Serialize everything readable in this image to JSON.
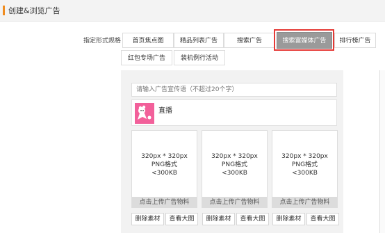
{
  "header": {
    "title": "创建&浏览广告",
    "accent_color": "#f08c1f"
  },
  "format": {
    "label": "指定形式规格",
    "options": [
      "首页焦点图",
      "精品列表广告",
      "搜索广告",
      "搜索富媒体广告",
      "排行榜广告",
      "红包专场广告",
      "装机例行活动"
    ],
    "selected": "搜索富媒体广告"
  },
  "editor": {
    "text_input_placeholder": "请输入广告宣传语（不超过20个字）",
    "live_label": "直播",
    "live_thumb_color": "#f2609a",
    "cards": [
      {
        "size": "320px * 320px",
        "format": "PNG格式",
        "limit": "<300KB",
        "upload_label": "点击上传广告物料",
        "delete_label": "删除素材",
        "view_label": "查看大图"
      },
      {
        "size": "320px * 320px",
        "format": "PNG格式",
        "limit": "<300KB",
        "upload_label": "点击上传广告物料",
        "delete_label": "删除素材",
        "view_label": "查看大图"
      },
      {
        "size": "320px * 320px",
        "format": "PNG格式",
        "limit": "<300KB",
        "upload_label": "点击上传广告物料",
        "delete_label": "删除素材",
        "view_label": "查看大图"
      }
    ]
  },
  "highlight_color": "#e53935"
}
